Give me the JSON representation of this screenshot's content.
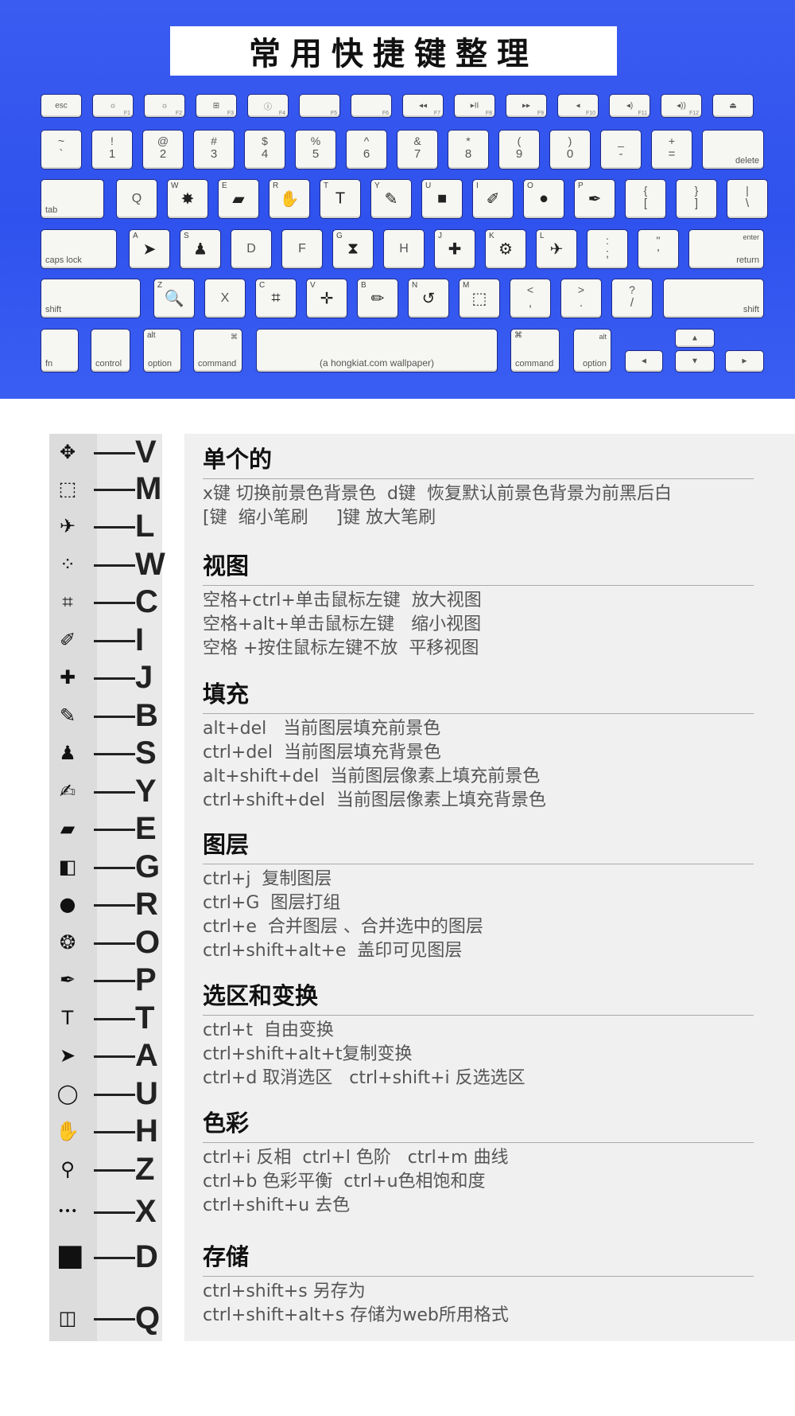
{
  "title": "常用快捷键整理",
  "keyboard": {
    "row_fn": [
      "esc",
      "☼",
      "☼",
      "⊞",
      "ⓘ",
      "",
      "",
      "◂◂",
      "▸II",
      "▸▸",
      "◂",
      "◂)",
      "◂))",
      "⏏"
    ],
    "row_fn_sub": [
      "",
      "F1",
      "F2",
      "F3",
      "F4",
      "F5",
      "F6",
      "F7",
      "F8",
      "F9",
      "F10",
      "F11",
      "F12",
      ""
    ],
    "row_num": [
      [
        "~",
        "`"
      ],
      [
        "!",
        "1"
      ],
      [
        "@",
        "2"
      ],
      [
        "#",
        "3"
      ],
      [
        "$",
        "4"
      ],
      [
        "%",
        "5"
      ],
      [
        "^",
        "6"
      ],
      [
        "&",
        "7"
      ],
      [
        "*",
        "8"
      ],
      [
        "(",
        "9"
      ],
      [
        ")",
        "0"
      ],
      [
        "_",
        "-"
      ],
      [
        "+",
        "="
      ]
    ],
    "delete": "delete",
    "tab": "tab",
    "row_q": [
      [
        "Q",
        ""
      ],
      [
        "W",
        "✸"
      ],
      [
        "E",
        "▰"
      ],
      [
        "R",
        "✋"
      ],
      [
        "T",
        "T"
      ],
      [
        "Y",
        "✎"
      ],
      [
        "U",
        "■"
      ],
      [
        "I",
        "✐"
      ],
      [
        "O",
        "●"
      ],
      [
        "P",
        "✒"
      ]
    ],
    "row_q_br": [
      [
        "{",
        "["
      ],
      [
        "}",
        "]"
      ],
      [
        "|",
        "\\"
      ]
    ],
    "capslock": "caps lock",
    "row_a": [
      [
        "A",
        "➤"
      ],
      [
        "S",
        "♟"
      ],
      [
        "D",
        ""
      ],
      [
        "F",
        ""
      ],
      [
        "G",
        "⧗"
      ],
      [
        "H",
        ""
      ],
      [
        "J",
        "✚"
      ],
      [
        "K",
        "⚙"
      ],
      [
        "L",
        "✈"
      ]
    ],
    "row_a_punct": [
      [
        ":",
        ";"
      ],
      [
        "\"",
        "'"
      ]
    ],
    "enter": "enter",
    "return": "return",
    "shift_l": "shift",
    "row_z": [
      [
        "Z",
        "🔍"
      ],
      [
        "X",
        ""
      ],
      [
        "C",
        "⌗"
      ],
      [
        "V",
        "✛"
      ],
      [
        "B",
        "✏"
      ],
      [
        "N",
        "↺"
      ],
      [
        "M",
        "⬚"
      ]
    ],
    "row_z_punct": [
      [
        "<",
        ","
      ],
      [
        ">",
        "."
      ],
      [
        "?",
        "/"
      ]
    ],
    "shift_r": "shift",
    "fn": "fn",
    "control": "control",
    "alt_l": "alt",
    "option_l": "option",
    "cmd_symbol": "⌘",
    "command_l": "command",
    "space": "(a hongkiat.com wallpaper)",
    "command_r": "command",
    "alt_r": "alt",
    "option_r": "option",
    "arrow_up": "▲",
    "arrow_left": "◄",
    "arrow_down": "▼",
    "arrow_right": "►"
  },
  "tools": [
    {
      "icon": "move-icon",
      "glyph": "✥",
      "letter": "V"
    },
    {
      "icon": "marquee-icon",
      "glyph": "⬚",
      "letter": "M"
    },
    {
      "icon": "lasso-icon",
      "glyph": "✈",
      "letter": "L"
    },
    {
      "icon": "quick-select-icon",
      "glyph": "⁘",
      "letter": "W"
    },
    {
      "icon": "crop-icon",
      "glyph": "⌗",
      "letter": "C"
    },
    {
      "icon": "eyedropper-icon",
      "glyph": "✐",
      "letter": "I"
    },
    {
      "icon": "healing-brush-icon",
      "glyph": "✚",
      "letter": "J"
    },
    {
      "icon": "pencil-icon",
      "glyph": "✎",
      "letter": "B"
    },
    {
      "icon": "stamp-icon",
      "glyph": "♟",
      "letter": "S"
    },
    {
      "icon": "history-brush-icon",
      "glyph": "✍",
      "letter": "Y"
    },
    {
      "icon": "eraser-icon",
      "glyph": "▰",
      "letter": "E"
    },
    {
      "icon": "gradient-icon",
      "glyph": "◧",
      "letter": "G"
    },
    {
      "icon": "blur-drop-icon",
      "glyph": "●",
      "letter": "R"
    },
    {
      "icon": "sponge-icon",
      "glyph": "❂",
      "letter": "O"
    },
    {
      "icon": "pen-icon",
      "glyph": "✒",
      "letter": "P"
    },
    {
      "icon": "type-icon",
      "glyph": "T",
      "letter": "T"
    },
    {
      "icon": "path-select-icon",
      "glyph": "➤",
      "letter": "A"
    },
    {
      "icon": "ellipse-icon",
      "glyph": "◯",
      "letter": "U"
    },
    {
      "icon": "hand-icon",
      "glyph": "✋",
      "letter": "H"
    },
    {
      "icon": "zoom-icon",
      "glyph": "⚲",
      "letter": "Z"
    },
    {
      "icon": "more-icon",
      "glyph": "•••",
      "letter": "X"
    },
    {
      "icon": "default-colors-icon",
      "glyph": "◼",
      "letter": "D"
    },
    {
      "icon": "quick-mask-icon",
      "glyph": "◫",
      "letter": "Q"
    }
  ],
  "sections": [
    {
      "title": "单个的",
      "lines": [
        "x键 切换前景色背景色  d键  恢复默认前景色背景为前黑后白",
        "[键  缩小笔刷     ]键 放大笔刷"
      ]
    },
    {
      "title": "视图",
      "lines": [
        "空格+ctrl+单击鼠标左键  放大视图",
        "空格+alt+单击鼠标左键   缩小视图",
        "空格 +按住鼠标左键不放  平移视图"
      ]
    },
    {
      "title": "填充",
      "lines": [
        "alt+del   当前图层填充前景色",
        "ctrl+del  当前图层填充背景色",
        "alt+shift+del  当前图层像素上填充前景色",
        "ctrl+shift+del  当前图层像素上填充背景色"
      ]
    },
    {
      "title": "图层",
      "lines": [
        "ctrl+j  复制图层",
        "ctrl+G  图层打组",
        "ctrl+e  合并图层 、合并选中的图层",
        "ctrl+shift+alt+e  盖印可见图层"
      ]
    },
    {
      "title": "选区和变换",
      "lines": [
        "ctrl+t  自由变换",
        "ctrl+shift+alt+t复制变换",
        "ctrl+d 取消选区   ctrl+shift+i 反选选区"
      ]
    },
    {
      "title": "色彩",
      "lines": [
        "ctrl+i 反相  ctrl+l 色阶   ctrl+m 曲线",
        "ctrl+b 色彩平衡  ctrl+u色相饱和度",
        "ctrl+shift+u 去色"
      ]
    },
    {
      "title": "存储",
      "lines": [
        "ctrl+shift+s 另存为",
        "ctrl+shift+alt+s 存储为web所用格式"
      ]
    }
  ]
}
